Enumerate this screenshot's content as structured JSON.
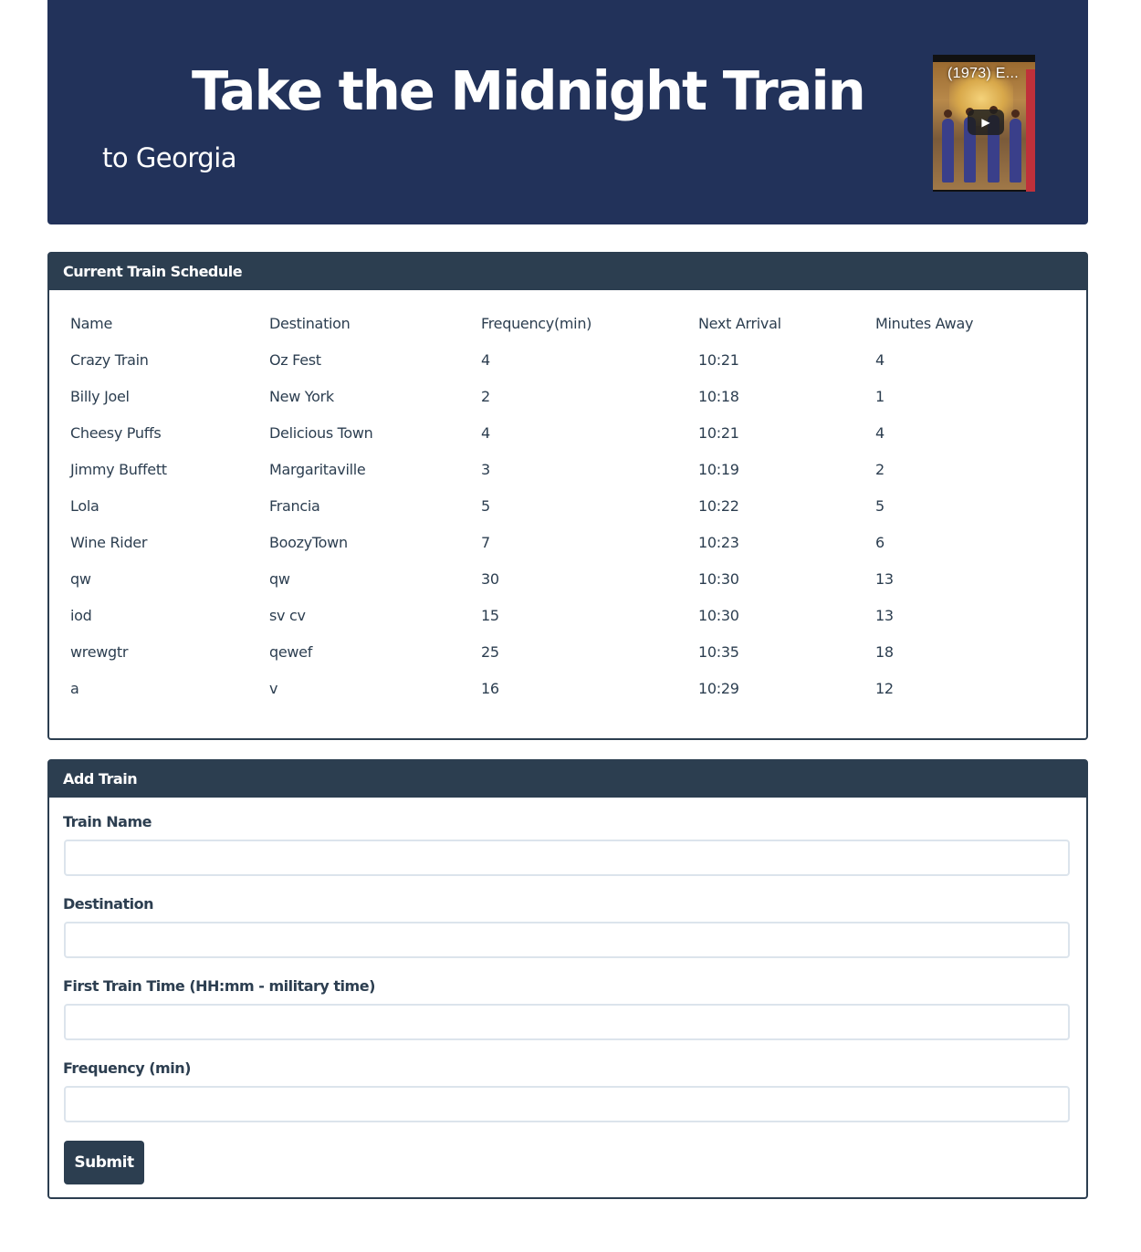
{
  "header": {
    "title": "Take the Midnight Train",
    "subtitle": "to Georgia",
    "video": {
      "title": "(1973) E...",
      "play_icon": "play-icon"
    }
  },
  "schedule": {
    "heading": "Current Train Schedule",
    "columns": [
      "Name",
      "Destination",
      "Frequency(min)",
      "Next Arrival",
      "Minutes Away"
    ],
    "rows": [
      [
        "Crazy Train",
        "Oz Fest",
        "4",
        "10:21",
        "4"
      ],
      [
        "Billy Joel",
        "New York",
        "2",
        "10:18",
        "1"
      ],
      [
        "Cheesy Puffs",
        "Delicious Town",
        "4",
        "10:21",
        "4"
      ],
      [
        "Jimmy Buffett",
        "Margaritaville",
        "3",
        "10:19",
        "2"
      ],
      [
        "Lola",
        "Francia",
        "5",
        "10:22",
        "5"
      ],
      [
        "Wine Rider",
        "BoozyTown",
        "7",
        "10:23",
        "6"
      ],
      [
        "qw",
        "qw",
        "30",
        "10:30",
        "13"
      ],
      [
        "iod",
        "sv cv",
        "15",
        "10:30",
        "13"
      ],
      [
        "wrewgtr",
        "qewef",
        "25",
        "10:35",
        "18"
      ],
      [
        "a",
        "v",
        "16",
        "10:29",
        "12"
      ]
    ]
  },
  "add_train": {
    "heading": "Add Train",
    "fields": {
      "name": {
        "label": "Train Name",
        "value": ""
      },
      "destination": {
        "label": "Destination",
        "value": ""
      },
      "first_time": {
        "label": "First Train Time (HH:mm - military time)",
        "value": ""
      },
      "frequency": {
        "label": "Frequency (min)",
        "value": ""
      }
    },
    "submit_label": "Submit"
  },
  "colors": {
    "jumbotron_bg": "#22325a",
    "panel_header_bg": "#2c3e50",
    "text": "#2c3e50",
    "input_border": "#dce4ec"
  }
}
